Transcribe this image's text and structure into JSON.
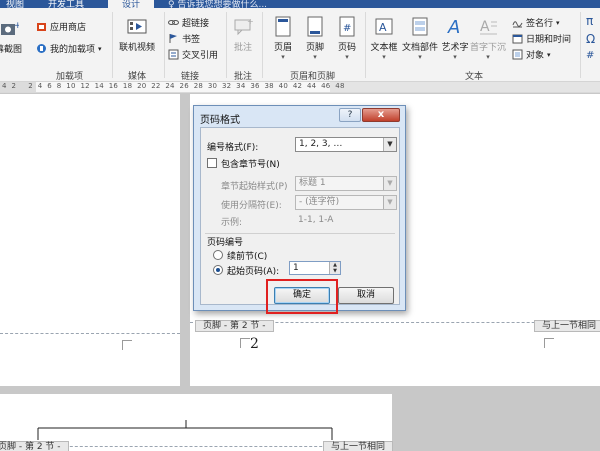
{
  "tabs": {
    "view": "视图",
    "developer": "开发工具",
    "design": "设计",
    "tell_me": "告诉我您想要做什么..."
  },
  "ribbon": {
    "groups": [
      {
        "label": "加载项",
        "items": [
          "应用商店",
          "我的加载项"
        ]
      },
      {
        "label": "媒体",
        "items": [
          "联机视频"
        ]
      },
      {
        "label": "链接",
        "items": [
          "超链接",
          "书签",
          "交叉引用"
        ]
      },
      {
        "label": "批注",
        "items": [
          "批注"
        ]
      },
      {
        "label": "页眉和页脚",
        "items": [
          "页眉",
          "页脚",
          "页码"
        ]
      },
      {
        "label": "文本",
        "items": [
          "文本框",
          "文档部件",
          "艺术字",
          "首字下沉",
          "签名行",
          "日期和时间",
          "对象"
        ]
      }
    ],
    "screenshot_label": "屏幕截图"
  },
  "ruler": {
    "numbers": "4  2     2  4  6  8  10  12  14  16  18  20  22  24  26  28  30  32  34  36  38  40  42  44  46  48"
  },
  "dialog": {
    "title": "页码格式",
    "help": "?",
    "close": "x",
    "number_format_label": "编号格式(F):",
    "number_format_value": "1, 2, 3, …",
    "include_chapter_label": "包含章节号(N)",
    "chapter_style_label": "章节起始样式(P)",
    "chapter_style_value": "标题 1",
    "separator_label": "使用分隔符(E):",
    "separator_value": "-   (连字符)",
    "example_label": "示例:",
    "example_value": "1-1, 1-A",
    "page_numbering_label": "页码编号",
    "continue_label": "续前节(C)",
    "start_at_label": "起始页码(A):",
    "start_at_value": "1",
    "ok_label": "确定",
    "cancel_label": "取消"
  },
  "document": {
    "footer_tag_top": "页脚 - 第 2 节 -",
    "same_as_prev_top": "与上一节相同",
    "page_number": "2",
    "footer_tag_bottom": "页脚 - 第 2 节 -",
    "same_as_prev_bottom": "与上一节相同"
  },
  "colors": {
    "accent": "#2b579a",
    "highlight": "#e02020",
    "dialog_frame": "#d9e6f5"
  }
}
